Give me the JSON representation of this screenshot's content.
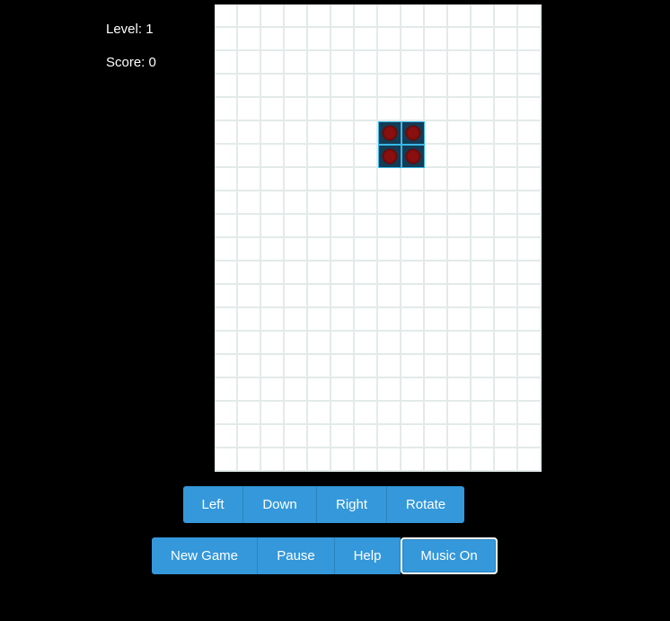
{
  "stats": {
    "level_label": "Level: 1",
    "score_label": "Score: 0"
  },
  "board": {
    "columns": 14,
    "rows": 20,
    "piece_color": "#143c54",
    "piece_glow": "#37b7e6",
    "piece_dot": "#8a0f0f",
    "grid_line": "#e3eaea",
    "filled_cells": [
      [
        7,
        5
      ],
      [
        8,
        5
      ],
      [
        7,
        6
      ],
      [
        8,
        6
      ]
    ]
  },
  "controls": {
    "left": "Left",
    "down": "Down",
    "right": "Right",
    "rotate": "Rotate"
  },
  "menu": {
    "new_game": "New Game",
    "pause": "Pause",
    "help": "Help",
    "music": "Music On"
  },
  "colors": {
    "button": "#3498db",
    "background": "#000000"
  }
}
